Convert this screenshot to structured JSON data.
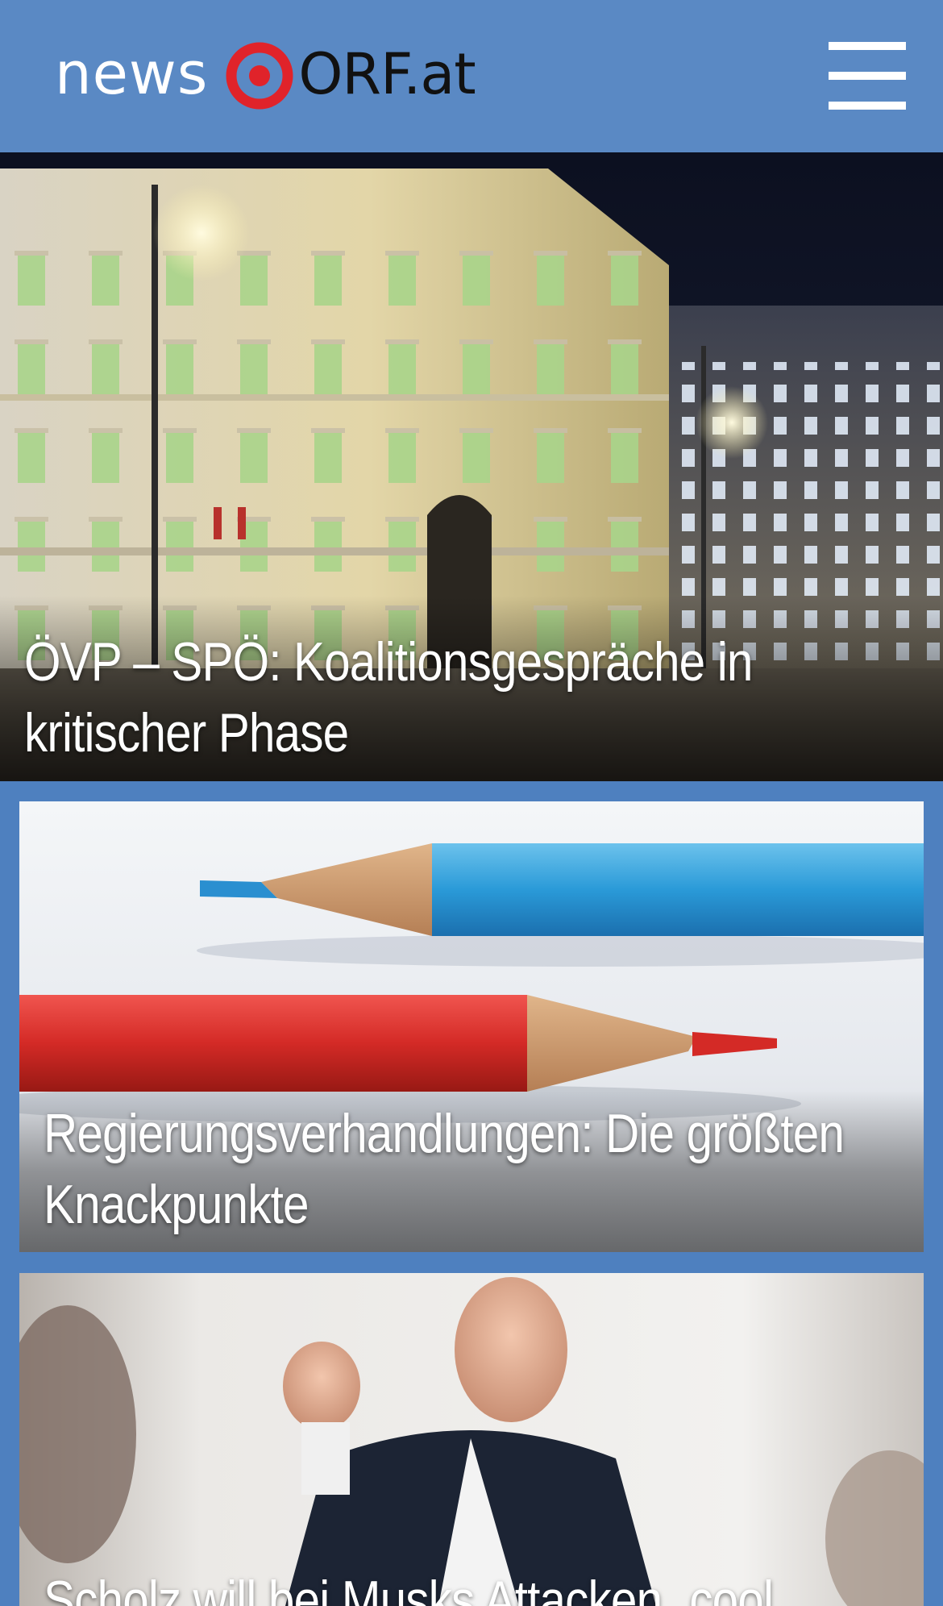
{
  "header": {
    "logo_news": "news",
    "logo_orf": "ORF.at"
  },
  "articles": [
    {
      "headline": "ÖVP – SPÖ: Koalitionsgespräche in kritischer Phase"
    },
    {
      "headline": "Regierungsverhandlungen: Die größten Knackpunkte"
    },
    {
      "headline": "Scholz will bei Musks Attacken „cool"
    }
  ],
  "colors": {
    "header_bg": "#5a89c4",
    "page_bg": "#4e80bf",
    "logo_red": "#e0232a"
  },
  "icons": {
    "menu": "hamburger-menu-icon",
    "logo": "orf-eye-logo-icon"
  }
}
